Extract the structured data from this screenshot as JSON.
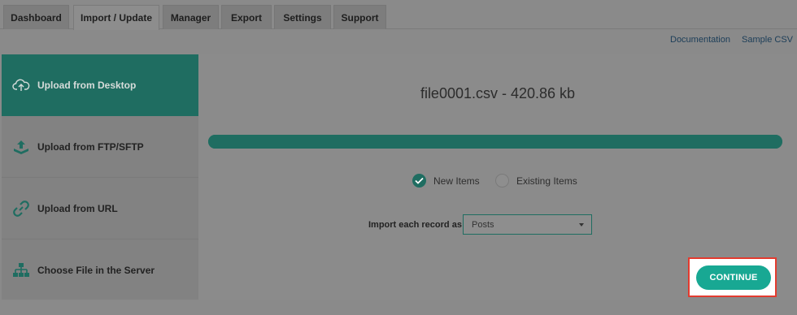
{
  "tabs": [
    {
      "label": "Dashboard"
    },
    {
      "label": "Import / Update",
      "active": true
    },
    {
      "label": "Manager"
    },
    {
      "label": "Export"
    },
    {
      "label": "Settings"
    },
    {
      "label": "Support"
    }
  ],
  "links": {
    "documentation": "Documentation",
    "sample_csv": "Sample CSV"
  },
  "sidebar": {
    "items": [
      {
        "label": "Upload from Desktop",
        "icon": "cloud-upload-icon",
        "active": true
      },
      {
        "label": "Upload from FTP/SFTP",
        "icon": "ftp-upload-icon"
      },
      {
        "label": "Upload from URL",
        "icon": "link-icon"
      },
      {
        "label": "Choose File in the Server",
        "icon": "server-tree-icon"
      }
    ]
  },
  "main": {
    "file_name": "file0001.csv - 420.86 kb",
    "progress_percent": 100,
    "radio": {
      "new_items": "New Items",
      "existing_items": "Existing Items",
      "selected": "new_items"
    },
    "import_record_label": "Import each record as",
    "import_record_value": "Posts",
    "continue_label": "CONTINUE"
  },
  "colors": {
    "accent": "#1f6d61",
    "continue": "#18a893",
    "highlight": "#e33b2f"
  }
}
